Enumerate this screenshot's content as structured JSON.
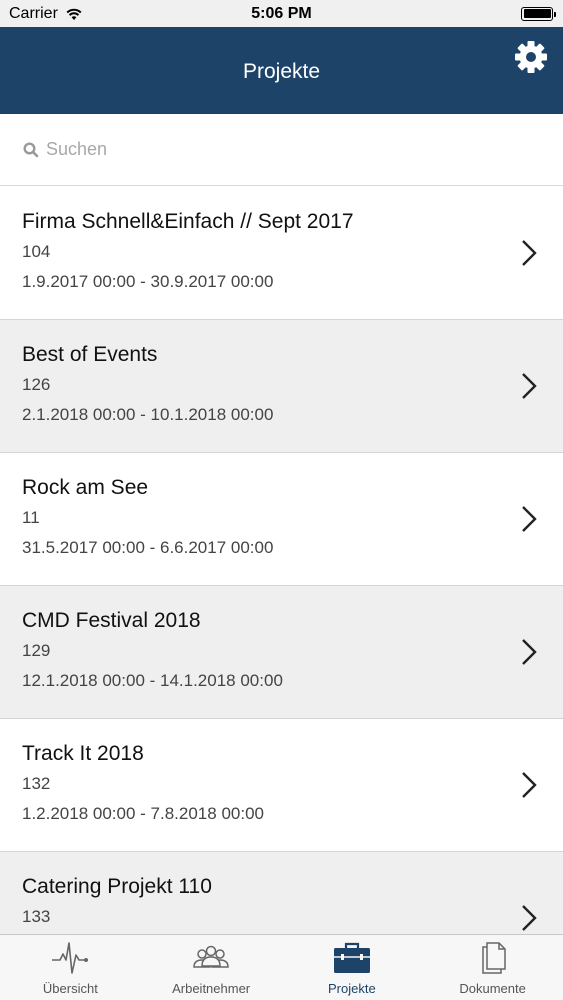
{
  "status_bar": {
    "carrier": "Carrier",
    "time": "5:06 PM"
  },
  "header": {
    "title": "Projekte"
  },
  "search": {
    "placeholder": "Suchen"
  },
  "projects": [
    {
      "title": "Firma Schnell&Einfach // Sept 2017",
      "number": "104",
      "dates": "1.9.2017 00:00 - 30.9.2017 00:00"
    },
    {
      "title": "Best of Events",
      "number": "126",
      "dates": "2.1.2018 00:00 - 10.1.2018 00:00"
    },
    {
      "title": "Rock am See",
      "number": "11",
      "dates": "31.5.2017 00:00 - 6.6.2017 00:00"
    },
    {
      "title": "CMD Festival 2018",
      "number": "129",
      "dates": "12.1.2018 00:00 - 14.1.2018 00:00"
    },
    {
      "title": "Track It 2018",
      "number": "132",
      "dates": "1.2.2018 00:00 - 7.8.2018 00:00"
    },
    {
      "title": "Catering Projekt 110",
      "number": "133",
      "dates": ""
    }
  ],
  "tabs": [
    {
      "label": "Übersicht",
      "icon": "activity-icon"
    },
    {
      "label": "Arbeitnehmer",
      "icon": "people-icon"
    },
    {
      "label": "Projekte",
      "icon": "briefcase-icon",
      "active": true
    },
    {
      "label": "Dokumente",
      "icon": "documents-icon"
    }
  ],
  "colors": {
    "nav_background": "#1d4468",
    "accent": "#1d4468",
    "alt_row": "#efeff0"
  }
}
